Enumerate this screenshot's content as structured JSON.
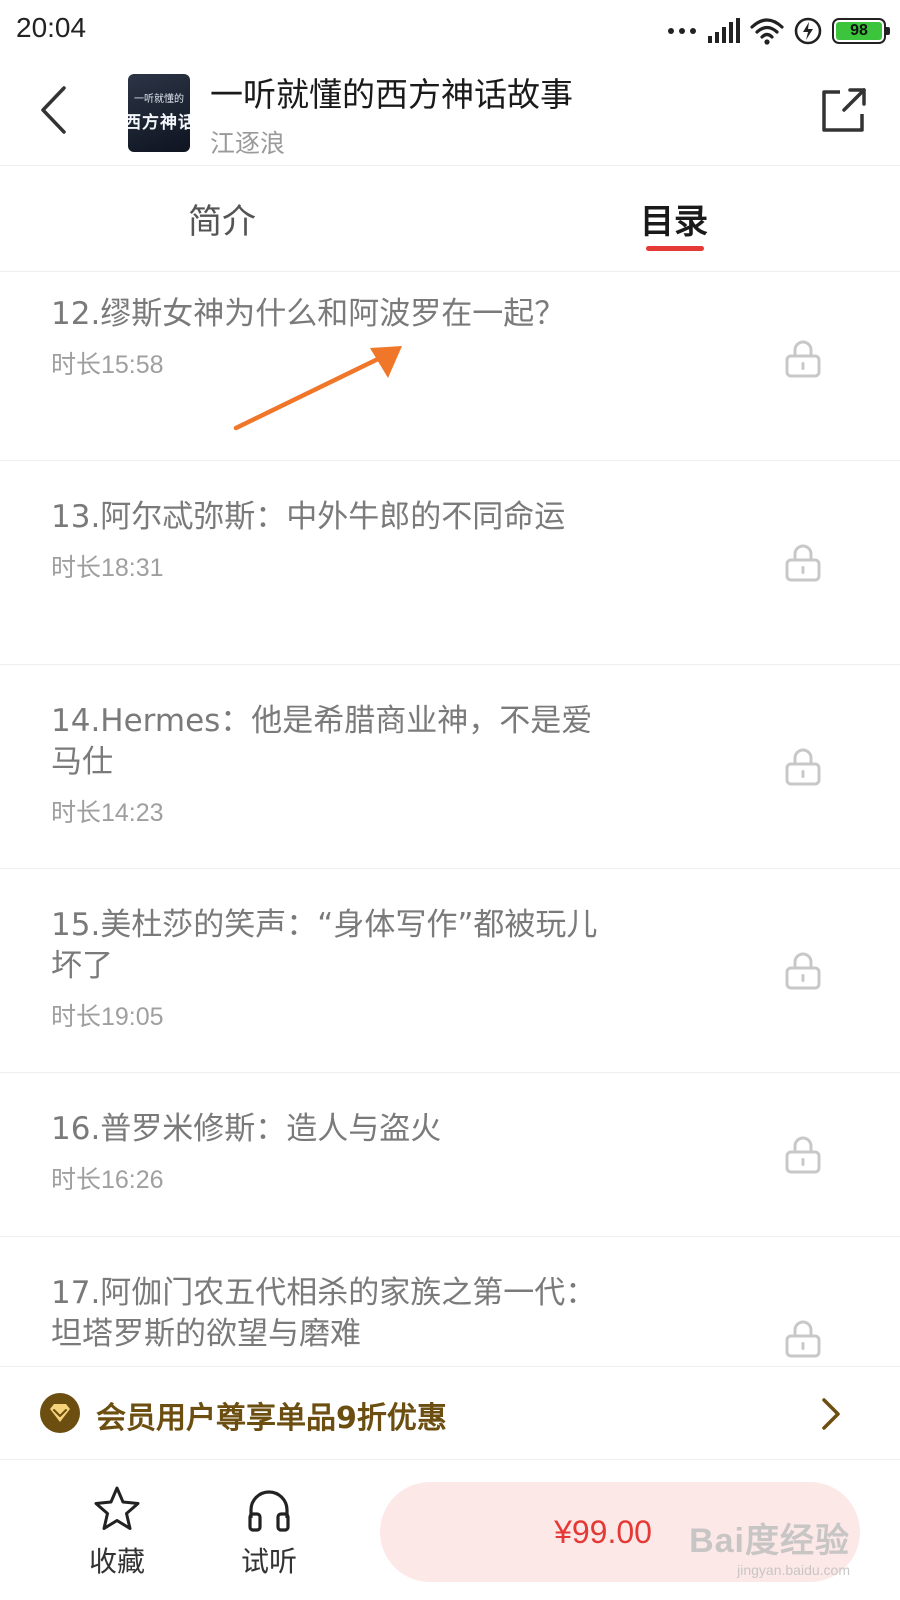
{
  "status_bar": {
    "time": "20:04",
    "battery": "98"
  },
  "header": {
    "cover_top_text": "一听就懂的",
    "cover_big_text": "西方神话故",
    "title": "一听就懂的西方神话故事",
    "author": "江逐浪"
  },
  "tabs": [
    {
      "label": "简介",
      "active": false
    },
    {
      "label": "目录",
      "active": true
    }
  ],
  "episodes": [
    {
      "title": "12.缪斯女神为什么和阿波罗在一起？",
      "duration": "时长15:58"
    },
    {
      "title": "13.阿尔忒弥斯：中外牛郎的不同命运",
      "duration": "时长18:31"
    },
    {
      "title": "14.Hermes：他是希腊商业神，不是爱马仕",
      "duration": "时长14:23"
    },
    {
      "title": "15.美杜莎的笑声：“身体写作”都被玩儿坏了",
      "duration": "时长19:05"
    },
    {
      "title": "16.普罗米修斯：造人与盗火",
      "duration": "时长16:26"
    },
    {
      "title": "17.阿伽门农五代相杀的家族之第一代：坦塔罗斯的欲望与磨难",
      "duration": ""
    }
  ],
  "promo": {
    "text": "会员用户尊享单品9折优惠"
  },
  "bottom_bar": {
    "favorite_label": "收藏",
    "listen_label": "试听",
    "price": "¥99.00"
  },
  "watermark": {
    "logo": "Bai度经验",
    "sub": "jingyan.baidu.com"
  },
  "colors": {
    "accent": "#e53935",
    "promo": "#6b4e10",
    "arrow": "#f0762a",
    "buy_bg": "#fde8e8"
  }
}
